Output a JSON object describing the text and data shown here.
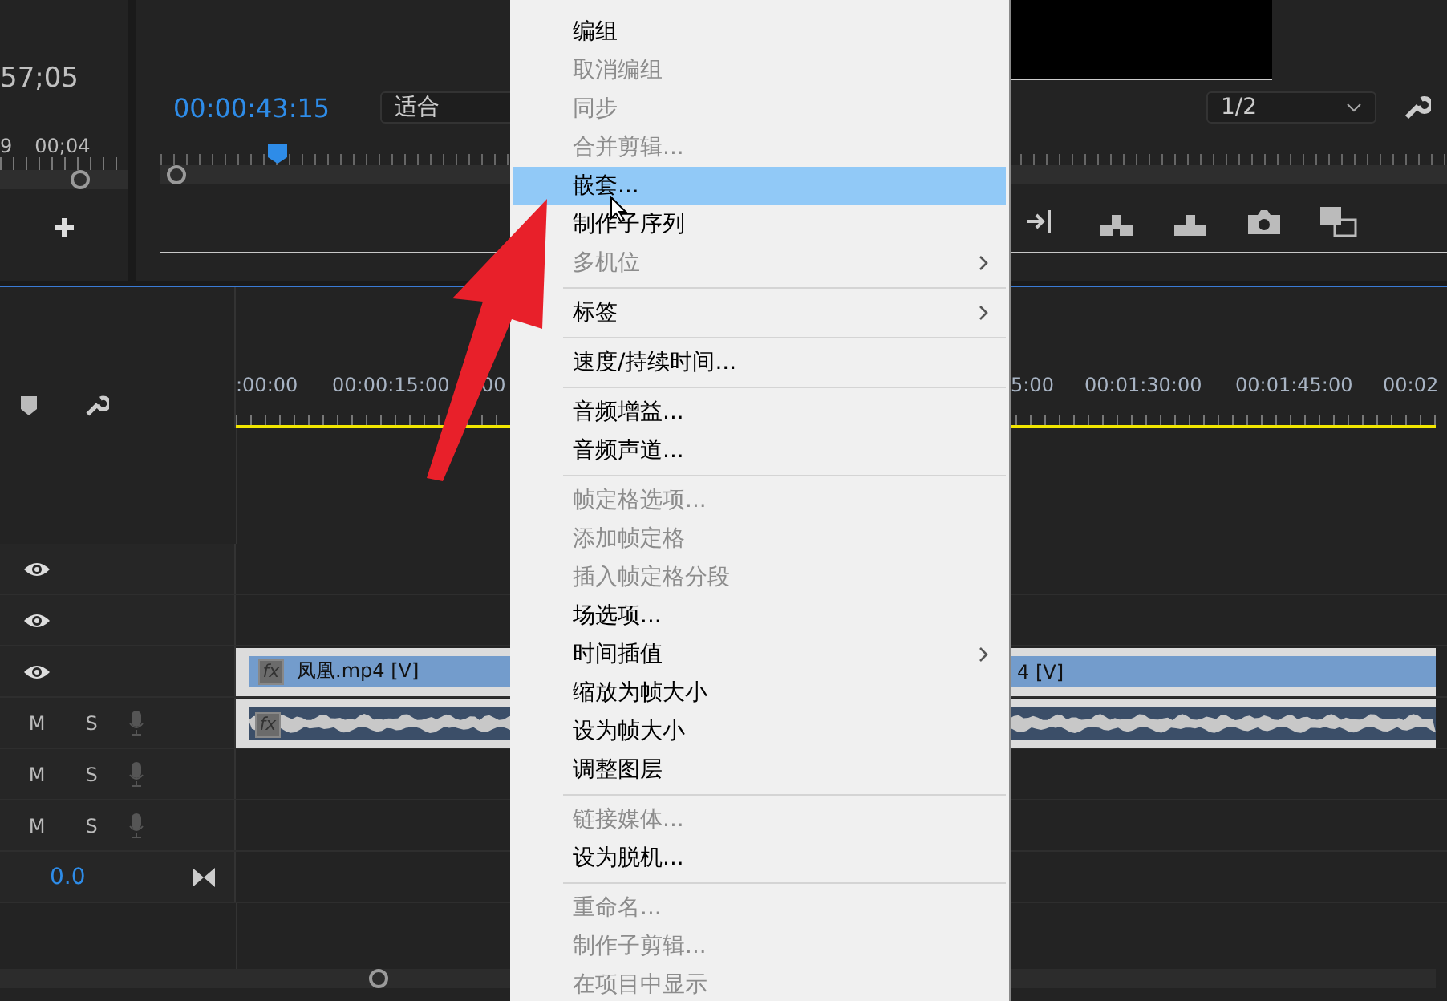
{
  "source_panel": {
    "timecode": "57;05",
    "ruler_labels": [
      "9",
      "00;04"
    ]
  },
  "program_monitor": {
    "timecode": "00:00:43:15",
    "zoom": "适合",
    "resolution": "1/2"
  },
  "timeline": {
    "ruler_labels": [
      ":00:00",
      "00:00:15:00",
      "00",
      "5:00",
      "00:01:30:00",
      "00:01:45:00",
      "00:02"
    ],
    "tracks": [
      {
        "kind": "video"
      },
      {
        "kind": "video"
      },
      {
        "kind": "video",
        "clip": {
          "badge": "fx",
          "labels": [
            "凤凰.mp4 [V]",
            "4 [V]"
          ]
        }
      },
      {
        "kind": "audio",
        "mute": "M",
        "solo": "S",
        "clip": {
          "badge": "fx"
        }
      },
      {
        "kind": "audio",
        "mute": "M",
        "solo": "S"
      },
      {
        "kind": "audio",
        "mute": "M",
        "solo": "S"
      },
      {
        "kind": "master",
        "value": "0.0"
      }
    ]
  },
  "context_menu": {
    "items": [
      {
        "kind": "item",
        "label": "编组",
        "disabled": false,
        "selected": false,
        "submenu": false
      },
      {
        "kind": "item",
        "label": "取消编组",
        "disabled": true,
        "selected": false,
        "submenu": false
      },
      {
        "kind": "item",
        "label": "同步",
        "disabled": true,
        "selected": false,
        "submenu": false
      },
      {
        "kind": "item",
        "label": "合并剪辑...",
        "disabled": true,
        "selected": false,
        "submenu": false
      },
      {
        "kind": "item",
        "label": "嵌套...",
        "disabled": false,
        "selected": true,
        "submenu": false
      },
      {
        "kind": "item",
        "label": "制作子序列",
        "disabled": false,
        "selected": false,
        "submenu": false
      },
      {
        "kind": "item",
        "label": "多机位",
        "disabled": true,
        "selected": false,
        "submenu": true
      },
      {
        "kind": "separator"
      },
      {
        "kind": "item",
        "label": "标签",
        "disabled": false,
        "selected": false,
        "submenu": true
      },
      {
        "kind": "separator"
      },
      {
        "kind": "item",
        "label": "速度/持续时间...",
        "disabled": false,
        "selected": false,
        "submenu": false
      },
      {
        "kind": "separator"
      },
      {
        "kind": "item",
        "label": "音频增益...",
        "disabled": false,
        "selected": false,
        "submenu": false
      },
      {
        "kind": "item",
        "label": "音频声道...",
        "disabled": false,
        "selected": false,
        "submenu": false
      },
      {
        "kind": "separator"
      },
      {
        "kind": "item",
        "label": "帧定格选项...",
        "disabled": true,
        "selected": false,
        "submenu": false
      },
      {
        "kind": "item",
        "label": "添加帧定格",
        "disabled": true,
        "selected": false,
        "submenu": false
      },
      {
        "kind": "item",
        "label": "插入帧定格分段",
        "disabled": true,
        "selected": false,
        "submenu": false
      },
      {
        "kind": "item",
        "label": "场选项...",
        "disabled": false,
        "selected": false,
        "submenu": false
      },
      {
        "kind": "item",
        "label": "时间插值",
        "disabled": false,
        "selected": false,
        "submenu": true
      },
      {
        "kind": "item",
        "label": "缩放为帧大小",
        "disabled": false,
        "selected": false,
        "submenu": false
      },
      {
        "kind": "item",
        "label": "设为帧大小",
        "disabled": false,
        "selected": false,
        "submenu": false
      },
      {
        "kind": "item",
        "label": "调整图层",
        "disabled": false,
        "selected": false,
        "submenu": false
      },
      {
        "kind": "separator"
      },
      {
        "kind": "item",
        "label": "链接媒体...",
        "disabled": true,
        "selected": false,
        "submenu": false
      },
      {
        "kind": "item",
        "label": "设为脱机...",
        "disabled": false,
        "selected": false,
        "submenu": false
      },
      {
        "kind": "separator"
      },
      {
        "kind": "item",
        "label": "重命名...",
        "disabled": true,
        "selected": false,
        "submenu": false
      },
      {
        "kind": "item",
        "label": "制作子剪辑...",
        "disabled": true,
        "selected": false,
        "submenu": false
      },
      {
        "kind": "item",
        "label": "在项目中显示",
        "disabled": true,
        "selected": false,
        "submenu": false
      }
    ]
  }
}
